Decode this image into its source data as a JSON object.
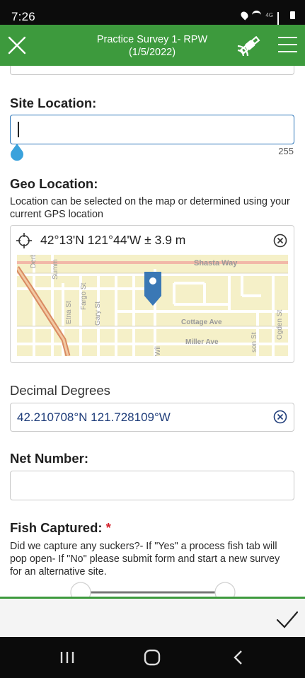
{
  "status_bar": {
    "time": "7:26",
    "network": "4G"
  },
  "app_bar": {
    "title_line1": "Practice Survey 1- RPW",
    "title_line2": "(1/5/2022)"
  },
  "form": {
    "site_location": {
      "label": "Site Location:",
      "value": "",
      "counter": "255"
    },
    "geo_location": {
      "label": "Geo Location:",
      "help": "Location can be selected on the map or determined using your current GPS location",
      "coordinates": "42°13'N 121°44'W ± 3.9 m",
      "map": {
        "streets": [
          "Shasta Way",
          "Cottage Ave",
          "Miller Ave",
          "Derby",
          "Summ",
          "Etna St",
          "Fargo St",
          "Gary St",
          "Wil",
          "son St",
          "Ogden St"
        ]
      }
    },
    "decimal_degrees": {
      "label": "Decimal Degrees",
      "value": "42.210708°N 121.728109°W"
    },
    "net_number": {
      "label": "Net Number:",
      "value": ""
    },
    "fish_captured": {
      "label": "Fish Captured:",
      "required_mark": "*",
      "help": "Did we capture any suckers?- If \"Yes\" a process fish tab will pop open- If \"No\" please submit form and start a new survey for an alternative site."
    }
  },
  "colors": {
    "brand_green": "#3d9a3d",
    "input_focus": "#2a74b8",
    "pin_blue": "#3a78b5",
    "required_red": "#d3202a"
  }
}
